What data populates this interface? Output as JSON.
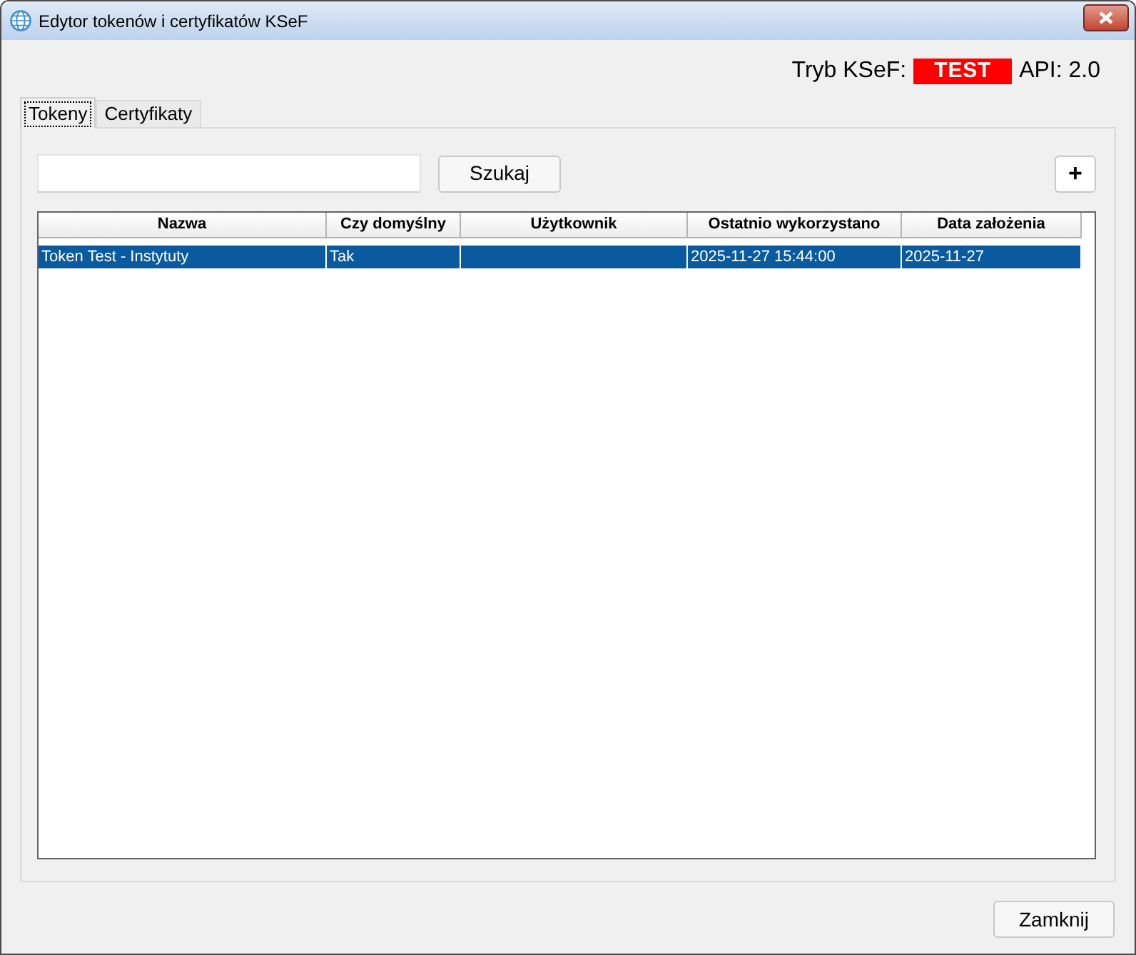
{
  "window": {
    "title": "Edytor tokenów i certyfikatów KSeF"
  },
  "mode": {
    "label": "Tryb KSeF:",
    "badge": "TEST",
    "api": "API: 2.0"
  },
  "tabs": [
    {
      "label": "Tokeny",
      "selected": true
    },
    {
      "label": "Certyfikaty",
      "selected": false
    }
  ],
  "search": {
    "button": "Szukaj"
  },
  "add_button": "+",
  "table": {
    "columns": [
      "Nazwa",
      "Czy domyślny",
      "Użytkownik",
      "Ostatnio wykorzystano",
      "Data założenia"
    ],
    "rows": [
      {
        "selected": true,
        "cells": [
          "Token Test - Instytuty",
          "Tak",
          "",
          "2025-11-27 15:44:00",
          "2025-11-27"
        ]
      }
    ]
  },
  "buttons": [
    "Zamknij"
  ]
}
